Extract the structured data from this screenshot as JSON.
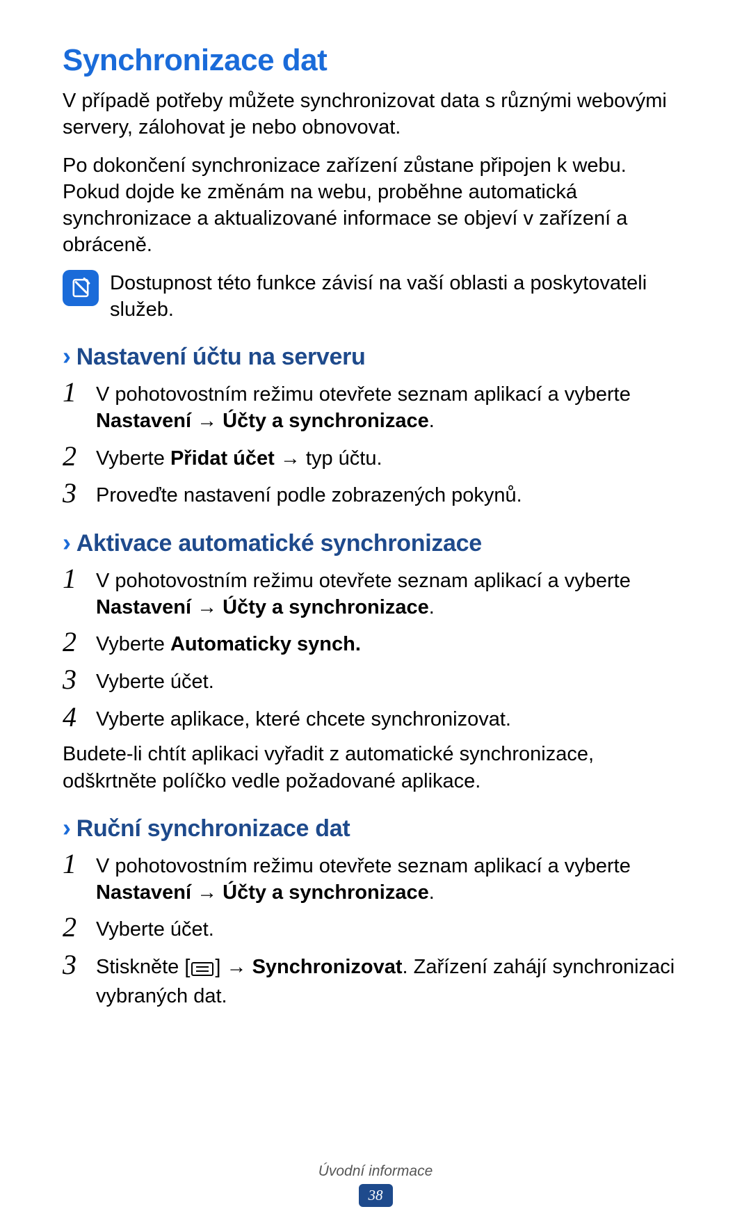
{
  "title": "Synchronizace dat",
  "intro1": "V případě potřeby můžete synchronizovat data s různými webovými servery, zálohovat je nebo obnovovat.",
  "intro2": "Po dokončení synchronizace zařízení zůstane připojen k webu. Pokud dojde ke změnám na webu, proběhne automatická synchronizace a aktualizované informace se objeví v zařízení a obráceně.",
  "note": "Dostupnost této funkce závisí na vaší oblasti a poskytovateli služeb.",
  "section1_title": "Nastavení účtu na serveru",
  "s1_step1_a": "V pohotovostním režimu otevřete seznam aplikací a vyberte ",
  "s1_step1_b": "Nastavení",
  "s1_step1_arrow": " → ",
  "s1_step1_c": "Účty a synchronizace",
  "s1_step1_end": ".",
  "s1_step2_a": "Vyberte ",
  "s1_step2_b": "Přidat účet",
  "s1_step2_c": " → typ účtu.",
  "s1_step3": "Proveďte nastavení podle zobrazených pokynů.",
  "section2_title": "Aktivace automatické synchronizace",
  "s2_step1_a": "V pohotovostním režimu otevřete seznam aplikací a vyberte ",
  "s2_step1_b": "Nastavení",
  "s2_step1_arrow": " → ",
  "s2_step1_c": "Účty a synchronizace",
  "s2_step1_end": ".",
  "s2_step2_a": "Vyberte ",
  "s2_step2_b": "Automaticky synch.",
  "s2_step3": "Vyberte účet.",
  "s2_step4": "Vyberte aplikace, které chcete synchronizovat.",
  "s2_after": "Budete-li chtít aplikaci vyřadit z automatické synchronizace, odškrtněte políčko vedle požadované aplikace.",
  "section3_title": "Ruční synchronizace dat",
  "s3_step1_a": "V pohotovostním režimu otevřete seznam aplikací a vyberte ",
  "s3_step1_b": "Nastavení",
  "s3_step1_arrow": " → ",
  "s3_step1_c": "Účty a synchronizace",
  "s3_step1_end": ".",
  "s3_step2": "Vyberte účet.",
  "s3_step3_a": "Stiskněte [",
  "s3_step3_b": "] → ",
  "s3_step3_c": "Synchronizovat",
  "s3_step3_d": ". Zařízení zahájí synchronizaci vybraných dat.",
  "footer_label": "Úvodní informace",
  "page_number": "38"
}
